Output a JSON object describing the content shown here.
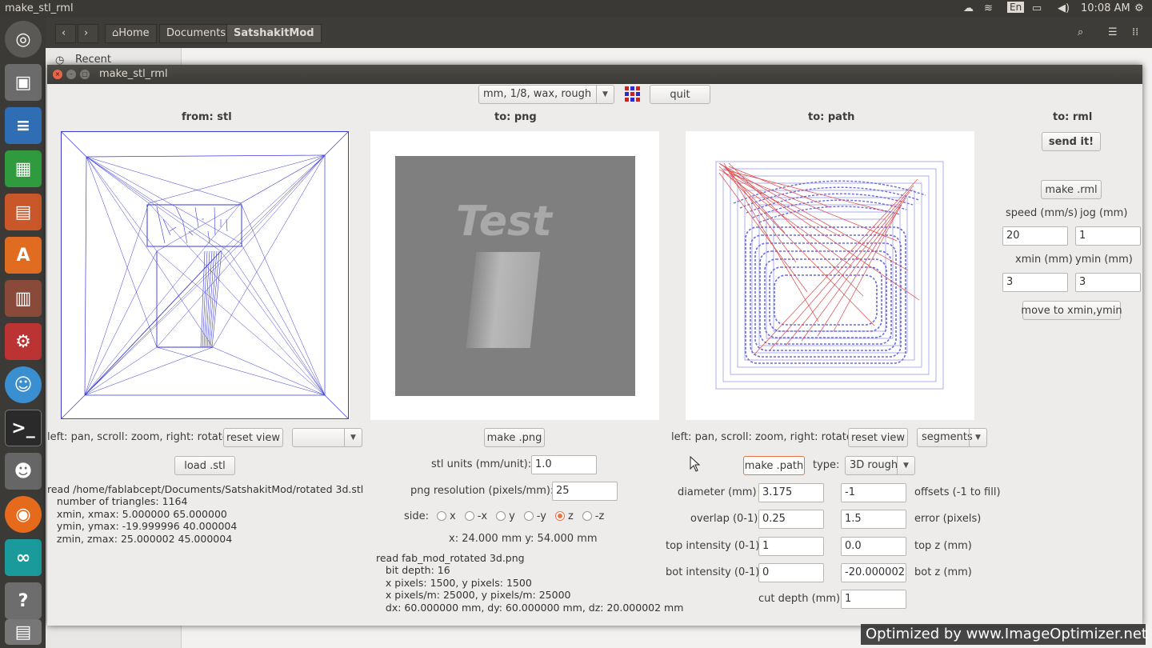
{
  "top_panel": {
    "app_title": "make_stl_rml",
    "keyboard": "En",
    "clock": "10:08 AM"
  },
  "nautilus": {
    "breadcrumbs": [
      "Home",
      "Documents",
      "SatshakitMod"
    ],
    "sidebar_recent": "Recent"
  },
  "window": {
    "title": "make_stl_rml",
    "preset": "mm, 1/8, wax, rough",
    "quit_label": "quit"
  },
  "stl": {
    "header": "from: stl",
    "hint": "left: pan, scroll: zoom, right: rotate",
    "reset_label": "reset view",
    "view_select": "",
    "load_label": "load .stl",
    "info_lines": [
      "read /home/fablabcept/Documents/SatshakitMod/rotated 3d.stl",
      "   number of triangles: 1164",
      "   xmin, xmax: 5.000000 65.000000",
      "   ymin, ymax: -19.999996 40.000004",
      "   zmin, zmax: 25.000002 45.000004"
    ]
  },
  "png": {
    "header": "to: png",
    "preview_text": "Test",
    "make_label": "make .png",
    "units_label": "stl units (mm/unit):",
    "units_value": "1.0",
    "resolution_label": "png resolution (pixels/mm):",
    "resolution_value": "25",
    "side_label": "side:",
    "sides": [
      "x",
      "-x",
      "y",
      "-y",
      "z",
      "-z"
    ],
    "side_selected": "z",
    "dims": "x: 24.000 mm  y: 54.000 mm",
    "info_lines": [
      "read fab_mod_rotated 3d.png",
      "   bit depth: 16",
      "   x pixels: 1500, y pixels: 1500",
      "   x pixels/m: 25000, y pixels/m: 25000",
      "   dx: 60.000000 mm, dy: 60.000000 mm, dz: 20.000002 mm"
    ]
  },
  "path": {
    "header": "to: path",
    "hint": "left: pan, scroll: zoom, right: rotate",
    "reset_label": "reset view",
    "display_select": "segments",
    "make_label": "make .path",
    "type_label": "type:",
    "type_value": "3D rough",
    "diameter_label": "diameter (mm)",
    "diameter_value": "3.175",
    "offsets_value": "-1",
    "offsets_label": "offsets (-1 to fill)",
    "overlap_label": "overlap (0-1)",
    "overlap_value": "0.25",
    "error_value": "1.5",
    "error_label": "error (pixels)",
    "top_intensity_label": "top intensity (0-1)",
    "top_intensity_value": "1",
    "top_z_value": "0.0",
    "top_z_label": "top z (mm)",
    "bot_intensity_label": "bot intensity (0-1)",
    "bot_intensity_value": "0",
    "bot_z_value": "-20.000002",
    "bot_z_label": "bot z (mm)",
    "cut_depth_label": "cut depth (mm)",
    "cut_depth_value": "1"
  },
  "rml": {
    "header": "to: rml",
    "send_label": "send it!",
    "make_label": "make .rml",
    "speed_label": "speed (mm/s)",
    "speed_value": "20",
    "jog_label": "jog (mm)",
    "jog_value": "1",
    "xmin_label": "xmin (mm)",
    "xmin_value": "3",
    "ymin_label": "ymin (mm)",
    "ymin_value": "3",
    "move_label": "move to xmin,ymin"
  },
  "watermark": "Optimized by www.ImageOptimizer.net",
  "colors": {
    "accent": "#e9744a",
    "mesh": "#3a3ad8",
    "path_blue": "#6a6adc",
    "path_red": "#e04848"
  }
}
